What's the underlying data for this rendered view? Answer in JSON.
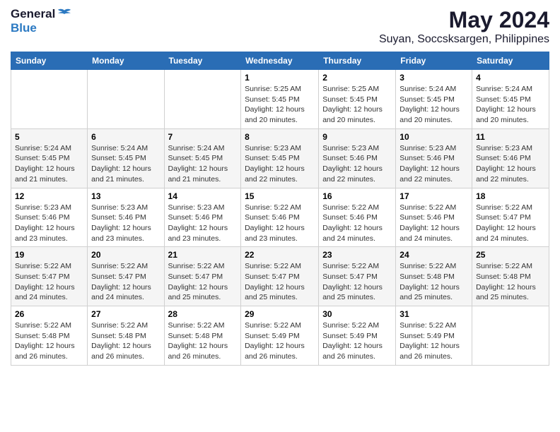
{
  "header": {
    "logo_general": "General",
    "logo_blue": "Blue",
    "month_title": "May 2024",
    "location": "Suyan, Soccsksargen, Philippines"
  },
  "days_of_week": [
    "Sunday",
    "Monday",
    "Tuesday",
    "Wednesday",
    "Thursday",
    "Friday",
    "Saturday"
  ],
  "weeks": [
    [
      {
        "day": "",
        "info": ""
      },
      {
        "day": "",
        "info": ""
      },
      {
        "day": "",
        "info": ""
      },
      {
        "day": "1",
        "info": "Sunrise: 5:25 AM\nSunset: 5:45 PM\nDaylight: 12 hours\nand 20 minutes."
      },
      {
        "day": "2",
        "info": "Sunrise: 5:25 AM\nSunset: 5:45 PM\nDaylight: 12 hours\nand 20 minutes."
      },
      {
        "day": "3",
        "info": "Sunrise: 5:24 AM\nSunset: 5:45 PM\nDaylight: 12 hours\nand 20 minutes."
      },
      {
        "day": "4",
        "info": "Sunrise: 5:24 AM\nSunset: 5:45 PM\nDaylight: 12 hours\nand 20 minutes."
      }
    ],
    [
      {
        "day": "5",
        "info": "Sunrise: 5:24 AM\nSunset: 5:45 PM\nDaylight: 12 hours\nand 21 minutes."
      },
      {
        "day": "6",
        "info": "Sunrise: 5:24 AM\nSunset: 5:45 PM\nDaylight: 12 hours\nand 21 minutes."
      },
      {
        "day": "7",
        "info": "Sunrise: 5:24 AM\nSunset: 5:45 PM\nDaylight: 12 hours\nand 21 minutes."
      },
      {
        "day": "8",
        "info": "Sunrise: 5:23 AM\nSunset: 5:45 PM\nDaylight: 12 hours\nand 22 minutes."
      },
      {
        "day": "9",
        "info": "Sunrise: 5:23 AM\nSunset: 5:46 PM\nDaylight: 12 hours\nand 22 minutes."
      },
      {
        "day": "10",
        "info": "Sunrise: 5:23 AM\nSunset: 5:46 PM\nDaylight: 12 hours\nand 22 minutes."
      },
      {
        "day": "11",
        "info": "Sunrise: 5:23 AM\nSunset: 5:46 PM\nDaylight: 12 hours\nand 22 minutes."
      }
    ],
    [
      {
        "day": "12",
        "info": "Sunrise: 5:23 AM\nSunset: 5:46 PM\nDaylight: 12 hours\nand 23 minutes."
      },
      {
        "day": "13",
        "info": "Sunrise: 5:23 AM\nSunset: 5:46 PM\nDaylight: 12 hours\nand 23 minutes."
      },
      {
        "day": "14",
        "info": "Sunrise: 5:23 AM\nSunset: 5:46 PM\nDaylight: 12 hours\nand 23 minutes."
      },
      {
        "day": "15",
        "info": "Sunrise: 5:22 AM\nSunset: 5:46 PM\nDaylight: 12 hours\nand 23 minutes."
      },
      {
        "day": "16",
        "info": "Sunrise: 5:22 AM\nSunset: 5:46 PM\nDaylight: 12 hours\nand 24 minutes."
      },
      {
        "day": "17",
        "info": "Sunrise: 5:22 AM\nSunset: 5:46 PM\nDaylight: 12 hours\nand 24 minutes."
      },
      {
        "day": "18",
        "info": "Sunrise: 5:22 AM\nSunset: 5:47 PM\nDaylight: 12 hours\nand 24 minutes."
      }
    ],
    [
      {
        "day": "19",
        "info": "Sunrise: 5:22 AM\nSunset: 5:47 PM\nDaylight: 12 hours\nand 24 minutes."
      },
      {
        "day": "20",
        "info": "Sunrise: 5:22 AM\nSunset: 5:47 PM\nDaylight: 12 hours\nand 24 minutes."
      },
      {
        "day": "21",
        "info": "Sunrise: 5:22 AM\nSunset: 5:47 PM\nDaylight: 12 hours\nand 25 minutes."
      },
      {
        "day": "22",
        "info": "Sunrise: 5:22 AM\nSunset: 5:47 PM\nDaylight: 12 hours\nand 25 minutes."
      },
      {
        "day": "23",
        "info": "Sunrise: 5:22 AM\nSunset: 5:47 PM\nDaylight: 12 hours\nand 25 minutes."
      },
      {
        "day": "24",
        "info": "Sunrise: 5:22 AM\nSunset: 5:48 PM\nDaylight: 12 hours\nand 25 minutes."
      },
      {
        "day": "25",
        "info": "Sunrise: 5:22 AM\nSunset: 5:48 PM\nDaylight: 12 hours\nand 25 minutes."
      }
    ],
    [
      {
        "day": "26",
        "info": "Sunrise: 5:22 AM\nSunset: 5:48 PM\nDaylight: 12 hours\nand 26 minutes."
      },
      {
        "day": "27",
        "info": "Sunrise: 5:22 AM\nSunset: 5:48 PM\nDaylight: 12 hours\nand 26 minutes."
      },
      {
        "day": "28",
        "info": "Sunrise: 5:22 AM\nSunset: 5:48 PM\nDaylight: 12 hours\nand 26 minutes."
      },
      {
        "day": "29",
        "info": "Sunrise: 5:22 AM\nSunset: 5:49 PM\nDaylight: 12 hours\nand 26 minutes."
      },
      {
        "day": "30",
        "info": "Sunrise: 5:22 AM\nSunset: 5:49 PM\nDaylight: 12 hours\nand 26 minutes."
      },
      {
        "day": "31",
        "info": "Sunrise: 5:22 AM\nSunset: 5:49 PM\nDaylight: 12 hours\nand 26 minutes."
      },
      {
        "day": "",
        "info": ""
      }
    ]
  ]
}
